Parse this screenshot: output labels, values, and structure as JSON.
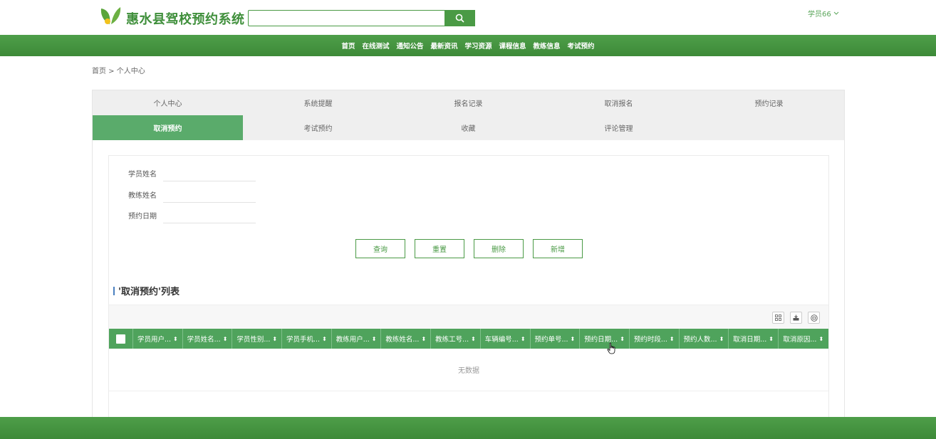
{
  "header": {
    "site_title": "惠水县驾校预约系统",
    "search": {
      "value": "",
      "placeholder": ""
    },
    "user_label": "学员66"
  },
  "nav": [
    "首页",
    "在线测试",
    "通知公告",
    "最新资讯",
    "学习资源",
    "课程信息",
    "教练信息",
    "考试预约"
  ],
  "breadcrumb": "首页 > 个人中心",
  "tabs": {
    "row1": [
      "个人中心",
      "系统提醒",
      "报名记录",
      "取消报名",
      "预约记录"
    ],
    "row2": [
      "取消预约",
      "考试预约",
      "收藏",
      "评论管理"
    ],
    "active": "取消预约"
  },
  "form": {
    "fields": [
      {
        "label": "学员姓名",
        "value": ""
      },
      {
        "label": "教练姓名",
        "value": ""
      },
      {
        "label": "预约日期",
        "value": ""
      }
    ]
  },
  "buttons": {
    "query": "查询",
    "reset": "重置",
    "delete": "删除",
    "add": "新增"
  },
  "list": {
    "title": "'取消预约'列表",
    "columns": [
      "学员用户...",
      "学员姓名...",
      "学员性别...",
      "学员手机...",
      "教练用户...",
      "教练姓名...",
      "教练工号...",
      "车辆编号...",
      "预约单号...",
      "预约日期...",
      "预约时段...",
      "预约人数...",
      "取消日期...",
      "取消原因..."
    ],
    "empty_text": "无数据"
  },
  "colors": {
    "brand_green": "#4a9a45",
    "active_tab": "#5aab6b",
    "table_header": "#4fa35c"
  },
  "icons": [
    "leaf-logo-icon",
    "search-icon",
    "chevron-down-icon",
    "columns-icon",
    "export-icon",
    "print-icon",
    "sort-icon",
    "hand-cursor-icon"
  ]
}
